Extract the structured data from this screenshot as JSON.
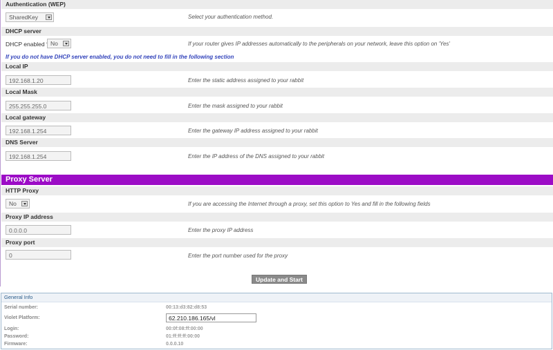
{
  "auth": {
    "header": "Authentication (WEP)",
    "select_value": "SharedKey",
    "hint": "Select your authentication method."
  },
  "dhcp": {
    "header": "DHCP server",
    "label": "DHCP enabled ?",
    "select_value": "No",
    "hint": "If your router gives IP addresses automatically to the peripherals on your network, leave this option on 'Yes'",
    "note": "If you do not have DHCP server enabled, you do not need to fill in the following section"
  },
  "local_ip": {
    "header": "Local IP",
    "value": "192.168.1.20",
    "hint": "Enter the static address assigned to your rabbit"
  },
  "local_mask": {
    "header": "Local Mask",
    "value": "255.255.255.0",
    "hint": "Enter the mask assigned to your rabbit"
  },
  "local_gateway": {
    "header": "Local gateway",
    "value": "192.168.1.254",
    "hint": "Enter the gateway IP address assigned to your rabbit"
  },
  "dns": {
    "header": "DNS Server",
    "value": "192.168.1.254",
    "hint": "Enter the IP address of the DNS assigned to your rabbit"
  },
  "proxy": {
    "banner": "Proxy Server",
    "http_header": "HTTP Proxy",
    "select_value": "No",
    "http_hint": "If you are accessing the Internet through a proxy, set this option to Yes and fill in the following fields",
    "ip_header": "Proxy IP address",
    "ip_value": "0.0.0.0",
    "ip_hint": "Enter the proxy IP address",
    "port_header": "Proxy port",
    "port_value": "0",
    "port_hint": "Enter the port number used for the proxy"
  },
  "submit_label": "Update and Start",
  "info": {
    "title": "General Info",
    "serial_label": "Serial number:",
    "serial_value": "00:13:d3:82:d8:53",
    "platform_label": "Violet Platform:",
    "platform_value": "62.210.186.165/vl",
    "login_label": "Login:",
    "login_value": "00:0f:08:ff:00:00",
    "password_label": "Password:",
    "password_value": "01:ff:ff:ff:00:00",
    "firmware_label": "Firmware:",
    "firmware_value": "0.0.0.10"
  },
  "colors": {
    "banner": "#9c0cc6",
    "note": "#3344bb",
    "info_title": "#2a5c8a"
  }
}
